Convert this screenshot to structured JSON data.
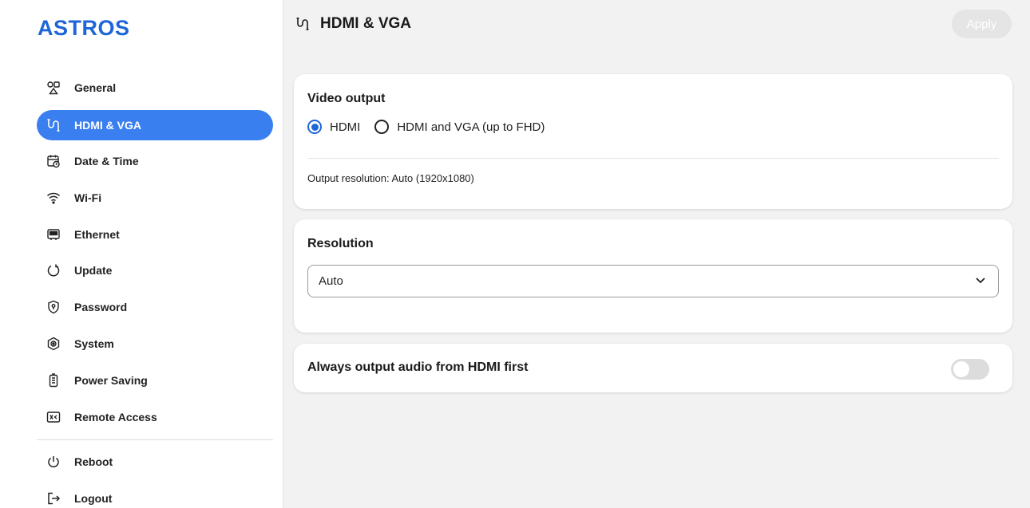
{
  "sidebar": {
    "logo": "ASTROS",
    "items": [
      {
        "label": "General",
        "icon": "shapes-icon"
      },
      {
        "label": "HDMI & VGA",
        "icon": "hdmi-icon"
      },
      {
        "label": "Date & Time",
        "icon": "calendar-clock-icon"
      },
      {
        "label": "Wi-Fi",
        "icon": "wifi-icon"
      },
      {
        "label": "Ethernet",
        "icon": "ethernet-icon"
      },
      {
        "label": "Update",
        "icon": "refresh-icon"
      },
      {
        "label": "Password",
        "icon": "shield-lock-icon"
      },
      {
        "label": "System",
        "icon": "settings-icon"
      },
      {
        "label": "Power Saving",
        "icon": "battery-icon"
      },
      {
        "label": "Remote Access",
        "icon": "remote-access-icon"
      },
      {
        "label": "Reboot",
        "icon": "power-icon"
      },
      {
        "label": "Logout",
        "icon": "logout-icon"
      }
    ],
    "active": "HDMI & VGA"
  },
  "header": {
    "title": "HDMI & VGA",
    "apply_label": "Apply"
  },
  "video_output": {
    "title": "Video output",
    "options": [
      "HDMI",
      "HDMI and VGA (up to FHD)"
    ],
    "selected": "HDMI",
    "output_resolution": "Output resolution: Auto (1920x1080)"
  },
  "resolution": {
    "title": "Resolution",
    "selected": "Auto"
  },
  "audio": {
    "label": "Always output audio from HDMI first",
    "enabled": false
  },
  "colors": {
    "accent": "#3a7ff0",
    "logo": "#1e66d8",
    "background": "#f2f2f2"
  }
}
